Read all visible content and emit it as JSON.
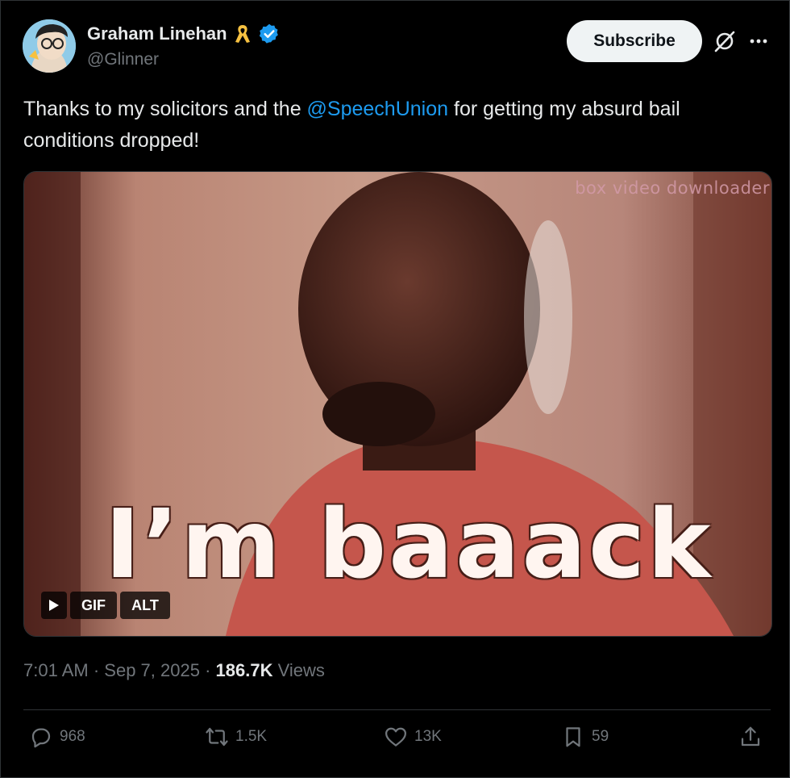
{
  "author": {
    "name": "Graham Linehan",
    "handle": "@Glinner",
    "badges": [
      "yellow-ribbon-icon",
      "verified-badge-icon"
    ]
  },
  "header_actions": {
    "subscribe_label": "Subscribe",
    "icons": [
      "grok-icon",
      "more-icon"
    ]
  },
  "tweet": {
    "text_before": "Thanks to my solicitors and the ",
    "mention": "@SpeechUnion",
    "text_after": " for getting my absurd bail conditions dropped!"
  },
  "media": {
    "type": "gif",
    "caption": "I’m baaack",
    "watermark": "box video downloader",
    "gif_label": "GIF",
    "alt_label": "ALT"
  },
  "meta": {
    "time": "7:01 AM",
    "separator": " · ",
    "date": "Sep 7, 2025",
    "views_count": "186.7K",
    "views_label": " Views"
  },
  "actions": {
    "replies": "968",
    "reposts": "1.5K",
    "likes": "13K",
    "bookmarks": "59"
  },
  "colors": {
    "background": "#000000",
    "text": "#e7e9ea",
    "muted": "#71767b",
    "link": "#1d9bf0",
    "verified": "#1d9bf0",
    "ribbon": "#f6c141"
  }
}
